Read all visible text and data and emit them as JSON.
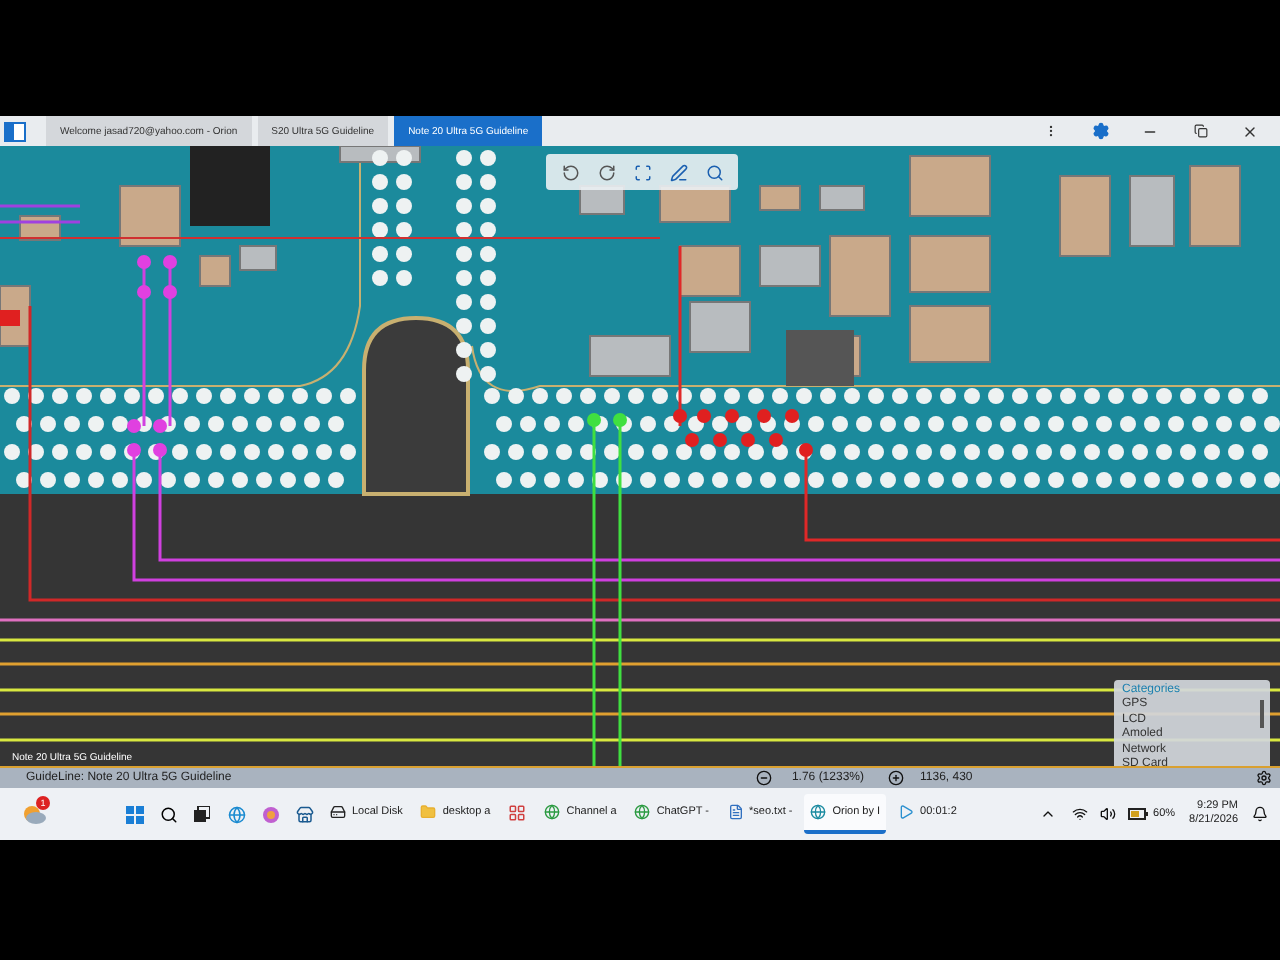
{
  "window": {
    "tabs": [
      {
        "label": "Welcome jasad720@yahoo.com - Orion",
        "selected": false
      },
      {
        "label": "S20 Ultra 5G Guideline",
        "selected": false
      },
      {
        "label": "Note 20 Ultra 5G Guideline",
        "selected": true
      }
    ]
  },
  "canvas": {
    "overlay_title": "Note 20 Ultra 5G Guideline"
  },
  "categories": {
    "title": "Categories",
    "items": [
      "GPS",
      "LCD",
      "Amoled",
      "Network",
      "SD Card"
    ]
  },
  "status_bar": {
    "guideline": "GuideLine: Note 20 Ultra 5G Guideline",
    "zoom": "1.76 (1233%)",
    "coords": "1136, 430"
  },
  "taskbar": {
    "notification_count": "1",
    "items": [
      {
        "kind": "drive",
        "label": "Local Disk",
        "selected": false
      },
      {
        "kind": "folder",
        "label": "desktop a",
        "selected": false
      },
      {
        "kind": "app",
        "selected": false
      },
      {
        "kind": "browser",
        "label": "Channel a",
        "selected": false
      },
      {
        "kind": "browser",
        "label": "ChatGPT -",
        "selected": false
      },
      {
        "kind": "notepad",
        "label": "*seo.txt -",
        "selected": false
      },
      {
        "kind": "orion",
        "label": "Orion by I",
        "selected": true
      },
      {
        "kind": "media",
        "label": "00:01:2",
        "selected": false
      }
    ],
    "battery": "60%",
    "time": "9:29 PM",
    "date": "8/21/2026"
  }
}
